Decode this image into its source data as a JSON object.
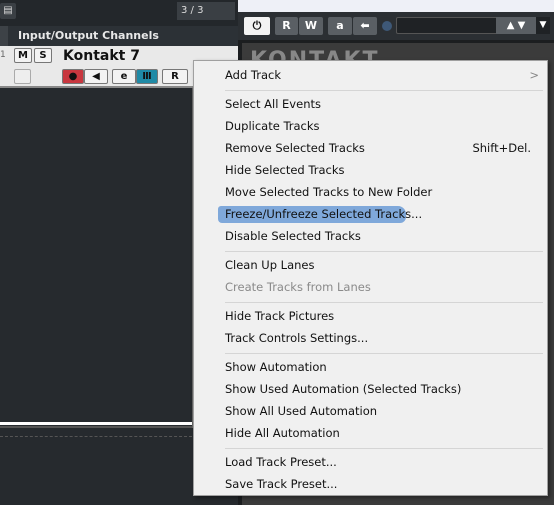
{
  "toolbar": {
    "page_count": "3 / 3"
  },
  "section": {
    "title": "Input/Output Channels"
  },
  "track": {
    "number": "1",
    "name": "Kontakt 7",
    "mute": "M",
    "solo": "S",
    "edit": "e",
    "read": "R"
  },
  "plugin": {
    "read": "R",
    "write": "W",
    "auto": "a",
    "logo": "KONTAKT"
  },
  "colors": {
    "record": "#c8373f",
    "instrument": "#1f8aa6",
    "highlight": "#6b9bd6"
  },
  "menu": {
    "items": [
      {
        "label": "Add Track",
        "submenu": true,
        "arrow": ">"
      },
      {
        "label": "Select All Events"
      },
      {
        "label": "Duplicate Tracks"
      },
      {
        "label": "Remove Selected Tracks",
        "shortcut": "Shift+Del."
      },
      {
        "label": "Hide Selected Tracks"
      },
      {
        "label": "Move Selected Tracks to New Folder"
      },
      {
        "label": "Freeze/Unfreeze Selected Tracks...",
        "highlighted": true
      },
      {
        "label": "Disable Selected Tracks"
      },
      {
        "label": "Clean Up Lanes"
      },
      {
        "label": "Create Tracks from Lanes",
        "disabled": true
      },
      {
        "label": "Hide Track Pictures"
      },
      {
        "label": "Track Controls Settings..."
      },
      {
        "label": "Show Automation"
      },
      {
        "label": "Show Used Automation (Selected Tracks)"
      },
      {
        "label": "Show All Used Automation"
      },
      {
        "label": "Hide All Automation"
      },
      {
        "label": "Load Track Preset..."
      },
      {
        "label": "Save Track Preset..."
      }
    ]
  }
}
